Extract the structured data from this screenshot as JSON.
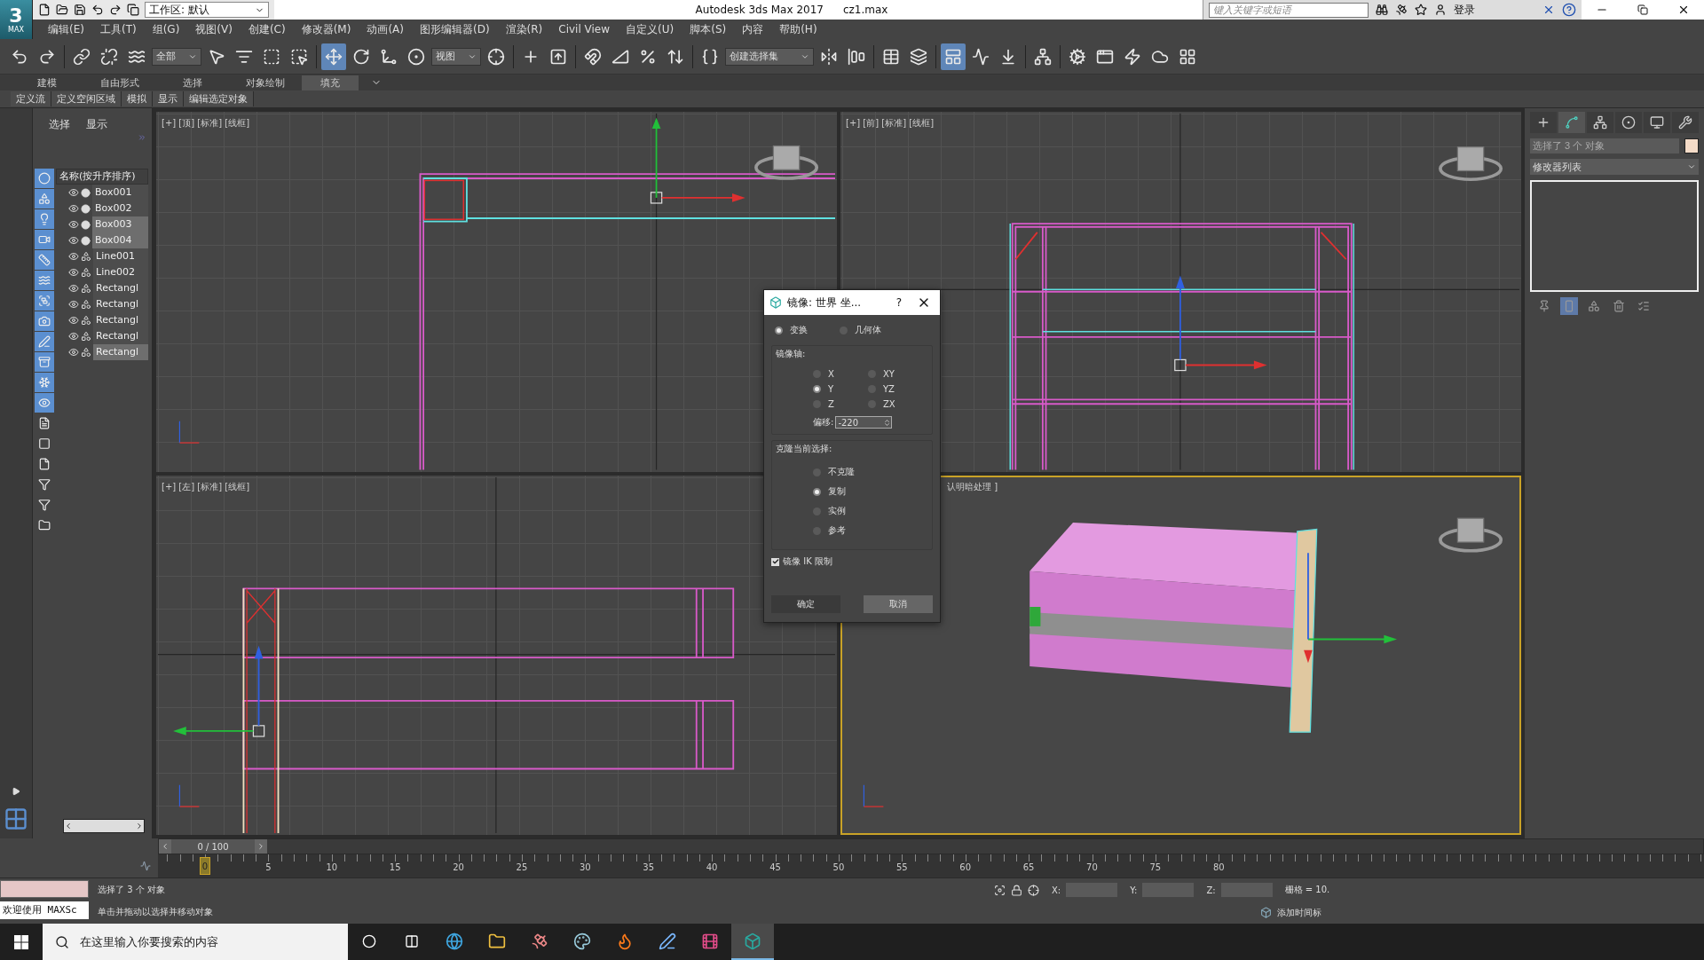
{
  "app": {
    "logo_glyph": "3",
    "logo_label": "MAX",
    "workspace": "工作区: 默认",
    "title": "Autodesk 3ds Max 2017",
    "file": "cz1.max",
    "search": {
      "placeholder": "键入关键字或短语"
    },
    "sign_in": "登录"
  },
  "menu": [
    "编辑(E)",
    "工具(T)",
    "组(G)",
    "视图(V)",
    "创建(C)",
    "修改器(M)",
    "动画(A)",
    "图形编辑器(D)",
    "渲染(R)",
    "Civil View",
    "自定义(U)",
    "脚本(S)",
    "内容",
    "帮助(H)"
  ],
  "toolbar": [
    {
      "kind": "undo",
      "selected": false
    },
    {
      "kind": "redo",
      "selected": false
    },
    {
      "kind": "sep"
    },
    {
      "kind": "link",
      "selected": false
    },
    {
      "kind": "unlink",
      "selected": false
    },
    {
      "kind": "bind",
      "selected": false
    },
    {
      "kind": "dropdown",
      "value": "全部"
    },
    {
      "kind": "select",
      "selected": false
    },
    {
      "kind": "select-by-name",
      "selected": false
    },
    {
      "kind": "region",
      "selected": false
    },
    {
      "kind": "window",
      "selected": false
    },
    {
      "kind": "sep"
    },
    {
      "kind": "move",
      "selected": true
    },
    {
      "kind": "rotate",
      "selected": false
    },
    {
      "kind": "scale",
      "selected": false
    },
    {
      "kind": "place",
      "selected": false
    },
    {
      "kind": "dropdown",
      "value": "视图"
    },
    {
      "kind": "pivot",
      "selected": false
    },
    {
      "kind": "sep"
    },
    {
      "kind": "manipulate",
      "selected": false
    },
    {
      "kind": "keyboard",
      "selected": false
    },
    {
      "kind": "sep"
    },
    {
      "kind": "snap",
      "selected": false
    },
    {
      "kind": "angle-snap",
      "selected": false
    },
    {
      "kind": "percent-snap",
      "selected": false
    },
    {
      "kind": "spinner-snap",
      "selected": false
    },
    {
      "kind": "sep"
    },
    {
      "kind": "named-sets",
      "selected": false
    },
    {
      "kind": "dropdown",
      "value": "创建选择集"
    },
    {
      "kind": "mirror",
      "selected": false
    },
    {
      "kind": "align",
      "selected": false
    },
    {
      "kind": "sep"
    },
    {
      "kind": "explorer",
      "selected": false
    },
    {
      "kind": "layers",
      "selected": false
    },
    {
      "kind": "sep"
    },
    {
      "kind": "ribbon",
      "selected": true
    },
    {
      "kind": "curve",
      "selected": false
    },
    {
      "kind": "schematic",
      "selected": false
    },
    {
      "kind": "sep"
    },
    {
      "kind": "material",
      "selected": false
    },
    {
      "kind": "sep"
    },
    {
      "kind": "render-setup",
      "selected": false
    },
    {
      "kind": "frame-window",
      "selected": false
    },
    {
      "kind": "render",
      "selected": false
    },
    {
      "kind": "render-cloud",
      "selected": false
    },
    {
      "kind": "grid",
      "selected": false
    }
  ],
  "ribbon": {
    "tabs": [
      {
        "label": "建模",
        "selected": false
      },
      {
        "label": "自由形式",
        "selected": false
      },
      {
        "label": "选择",
        "selected": false
      },
      {
        "label": "对象绘制",
        "selected": false
      },
      {
        "label": "填充",
        "selected": true
      }
    ],
    "panels": [
      "定义流",
      "定义空闲区域",
      "模拟",
      "显示",
      "编辑选定对象"
    ]
  },
  "scene_explorer": {
    "tabs": [
      "选择",
      "显示"
    ],
    "column": "名称(按升序排序)",
    "items": [
      {
        "name": "Box001",
        "kind": "geometry",
        "selected": false
      },
      {
        "name": "Box002",
        "kind": "geometry",
        "selected": false
      },
      {
        "name": "Box003",
        "kind": "geometry",
        "selected": true
      },
      {
        "name": "Box004",
        "kind": "geometry",
        "selected": true
      },
      {
        "name": "Line001",
        "kind": "shape",
        "selected": false
      },
      {
        "name": "Line002",
        "kind": "shape",
        "selected": false
      },
      {
        "name": "Rectangl",
        "kind": "shape",
        "selected": false
      },
      {
        "name": "Rectangl",
        "kind": "shape",
        "selected": false
      },
      {
        "name": "Rectangl",
        "kind": "shape",
        "selected": false
      },
      {
        "name": "Rectangl",
        "kind": "shape",
        "selected": false
      },
      {
        "name": "Rectangl",
        "kind": "shape",
        "selected": true
      }
    ]
  },
  "viewports": [
    {
      "kind": "top",
      "label": "[+] [顶] [标准] [线框]",
      "active": false
    },
    {
      "kind": "front",
      "label": "[+] [前] [标准] [线框]",
      "active": false
    },
    {
      "kind": "left",
      "label": "[+] [左] [标准] [线框]",
      "active": false
    },
    {
      "kind": "perspective",
      "label": "认明暗处理 ]",
      "active": true
    }
  ],
  "dialog": {
    "title": "镜像: 世界 坐...",
    "help": "?",
    "mode_options": [
      {
        "label": "变换",
        "selected": true
      },
      {
        "label": "几何体",
        "selected": false
      }
    ],
    "axis_group": "镜像轴:",
    "axes": [
      {
        "label": "X",
        "selected": false
      },
      {
        "label": "XY",
        "selected": false
      },
      {
        "label": "Y",
        "selected": true
      },
      {
        "label": "YZ",
        "selected": false
      },
      {
        "label": "Z",
        "selected": false
      },
      {
        "label": "ZX",
        "selected": false
      }
    ],
    "offset_label": "偏移:",
    "offset_value": "-220",
    "clone_group": "克隆当前选择:",
    "clone_options": [
      {
        "label": "不克隆",
        "selected": false
      },
      {
        "label": "复制",
        "selected": true
      },
      {
        "label": "实例",
        "selected": false
      },
      {
        "label": "参考",
        "selected": false
      }
    ],
    "ik": {
      "label": "镜像 IK 限制",
      "checked": true
    },
    "buttons": [
      "确定",
      "取消"
    ]
  },
  "command_panel": {
    "tabs": [
      {
        "kind": "create",
        "selected": false
      },
      {
        "kind": "modify",
        "selected": true
      },
      {
        "kind": "hierarchy",
        "selected": false
      },
      {
        "kind": "motion",
        "selected": false
      },
      {
        "kind": "display",
        "selected": false
      },
      {
        "kind": "utilities",
        "selected": false
      }
    ],
    "name_field": "选择了 3 个 对象",
    "modifier_list": "修改器列表"
  },
  "time_slider": {
    "position": "0 / 100",
    "level": 0
  },
  "track_bar": {
    "current_frame": "0",
    "labels": [
      "5",
      "10",
      "15",
      "20",
      "25",
      "30",
      "35",
      "40",
      "45",
      "50",
      "55",
      "60",
      "65",
      "70",
      "75",
      "80"
    ]
  },
  "status": {
    "listener_text": "欢迎使用 MAXSc",
    "message": "选择了 3 个 对象",
    "prompt": "单击并拖动以选择并移动对象",
    "coords": [
      "X:",
      "Y:",
      "Z:"
    ],
    "grid": "栅格 = 10.",
    "time_tag": "添加时间标"
  },
  "taskbar": {
    "search_placeholder": "在这里输入你要搜索的内容",
    "apps": [
      {
        "kind": "edge",
        "selected": false
      },
      {
        "kind": "folder",
        "selected": false
      },
      {
        "kind": "satellite",
        "selected": false
      },
      {
        "kind": "palette",
        "selected": false
      },
      {
        "kind": "firefox",
        "selected": false
      },
      {
        "kind": "pen",
        "selected": false
      },
      {
        "kind": "media",
        "selected": false
      },
      {
        "kind": "max",
        "selected": true
      }
    ]
  }
}
